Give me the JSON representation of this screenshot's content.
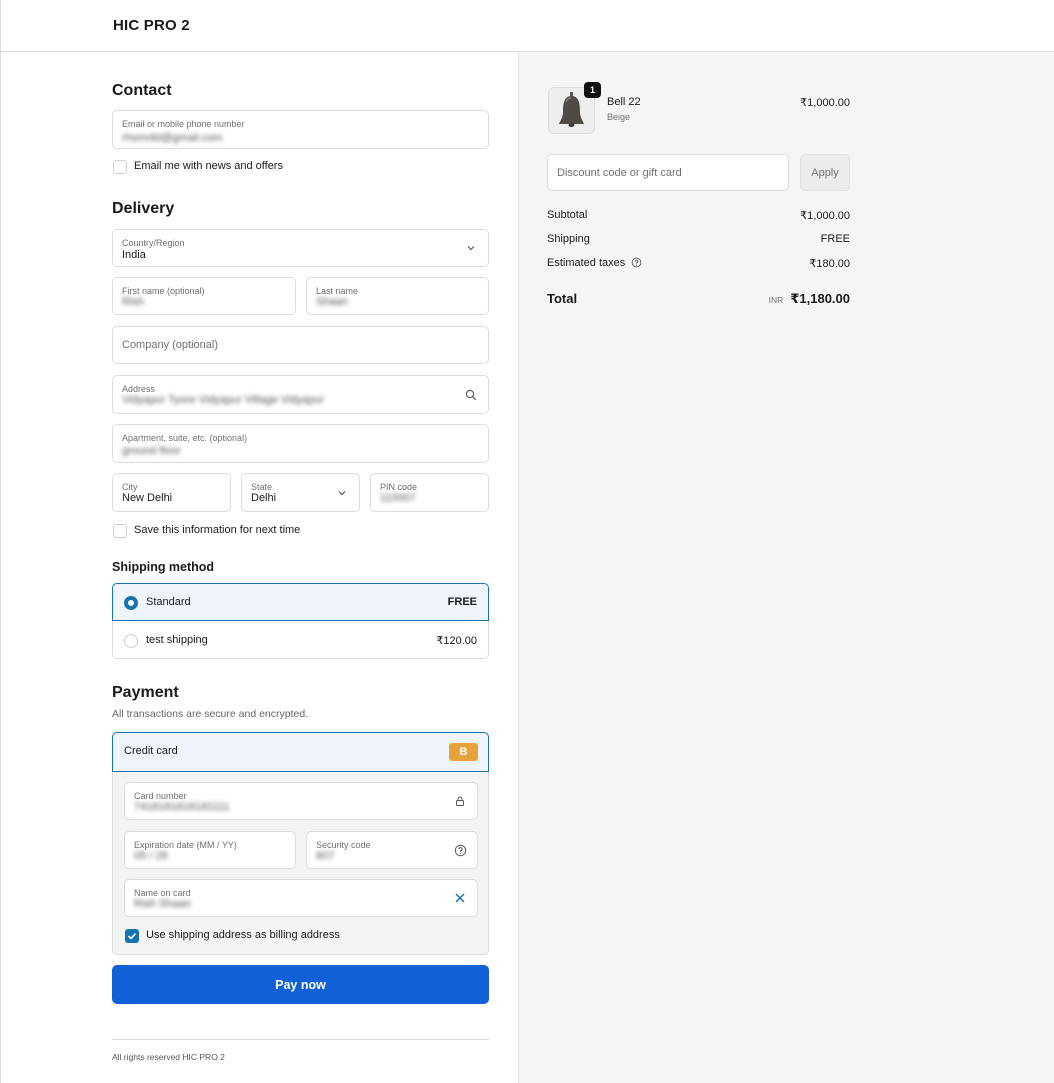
{
  "store": {
    "name": "HIC PRO 2"
  },
  "contact": {
    "title": "Contact",
    "email": {
      "label": "Email or mobile phone number",
      "value": "rhsmnbl@gmail.com"
    },
    "news_label": "Email me with news and offers"
  },
  "delivery": {
    "title": "Delivery",
    "country": {
      "label": "Country/Region",
      "value": "India"
    },
    "first_name": {
      "label": "First name (optional)",
      "value": "Rish"
    },
    "last_name": {
      "label": "Last name",
      "value": "Shaan"
    },
    "company": {
      "placeholder": "Company (optional)"
    },
    "address": {
      "label": "Address",
      "value": "Vidyapur Tyore Vidyapur Village Vidyapur"
    },
    "apartment": {
      "label": "Apartment, suite, etc. (optional)",
      "value": "ground floor"
    },
    "city": {
      "label": "City",
      "value": "New Delhi"
    },
    "state": {
      "label": "State",
      "value": "Delhi"
    },
    "pin": {
      "label": "PIN code",
      "value": "110007"
    },
    "save_label": "Save this information for next time"
  },
  "shipping": {
    "title": "Shipping method",
    "options": [
      {
        "name": "Standard",
        "price": "FREE",
        "selected": true
      },
      {
        "name": "test shipping",
        "price": "₹120.00",
        "selected": false
      }
    ]
  },
  "payment": {
    "title": "Payment",
    "subtitle": "All transactions are secure and encrypted.",
    "method": "Credit card",
    "badge": "B",
    "card_number": {
      "label": "Card number",
      "value": "7418181818181111"
    },
    "expiry": {
      "label": "Expiration date (MM / YY)",
      "value": "05 / 28"
    },
    "cvv": {
      "label": "Security code",
      "value": "607"
    },
    "name_on_card": {
      "label": "Name on card",
      "value": "Rish Shaan"
    },
    "billing_label": "Use shipping address as billing address",
    "pay_label": "Pay now"
  },
  "footer": {
    "text": "All rights reserved HIC PRO 2"
  },
  "summary": {
    "item": {
      "name": "Bell 22",
      "variant": "Beige",
      "price": "₹1,000.00",
      "qty": "1"
    },
    "discount": {
      "placeholder": "Discount code or gift card",
      "apply_label": "Apply"
    },
    "subtotal": {
      "label": "Subtotal",
      "value": "₹1,000.00"
    },
    "shipping": {
      "label": "Shipping",
      "value": "FREE"
    },
    "taxes": {
      "label": "Estimated taxes",
      "value": "₹180.00"
    },
    "total": {
      "label": "Total",
      "currency": "INR",
      "value": "₹1,180.00"
    }
  },
  "colors": {
    "accent": "#1773b0",
    "pay_button": "#1061d8",
    "badge": "#e8a23a"
  }
}
